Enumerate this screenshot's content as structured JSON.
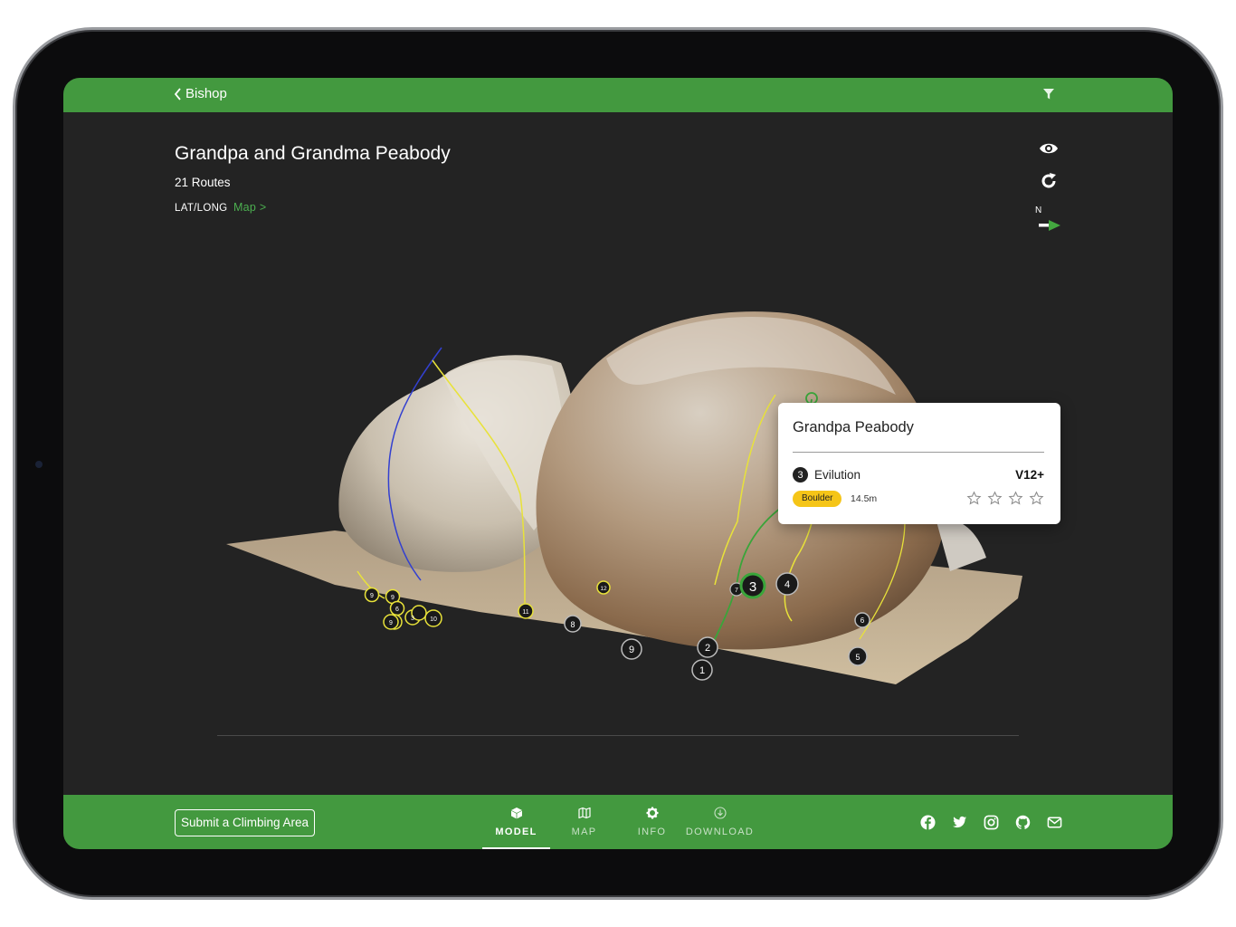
{
  "topbar": {
    "back_label": "Bishop",
    "filter_icon": "filter-icon"
  },
  "area": {
    "title": "Grandpa and Grandma Peabody",
    "routes": "21 Routes",
    "latlong_label": "LAT/LONG",
    "map_link": "Map >"
  },
  "controls": {
    "north_label": "N",
    "icons": [
      "eye-icon",
      "rotate-icon",
      "compass-arrow-icon"
    ]
  },
  "markers": {
    "big": [
      "3",
      "4",
      "2",
      "1",
      "9",
      "5",
      "6",
      "8",
      "7"
    ],
    "small": [
      "12",
      "11",
      "10",
      "8",
      "9",
      "6",
      "3"
    ]
  },
  "card": {
    "boulder_name": "Grandpa Peabody",
    "route_number": "3",
    "route_name": "Evilution",
    "grade": "V12+",
    "type": "Boulder",
    "length": "14.5m",
    "stars": 4
  },
  "bottombar": {
    "submit_label": "Submit a Climbing Area",
    "tabs": [
      {
        "label": "MODEL",
        "active": true
      },
      {
        "label": "MAP",
        "active": false
      },
      {
        "label": "INFO",
        "active": false
      },
      {
        "label": "DOWNLOAD",
        "active": false
      }
    ],
    "socials": [
      "facebook-icon",
      "twitter-icon",
      "instagram-icon",
      "github-icon",
      "email-icon"
    ]
  },
  "colors": {
    "brand_green": "#43993f",
    "link_green": "#4caf50",
    "background": "#232323",
    "badge_yellow": "#f5c518"
  }
}
